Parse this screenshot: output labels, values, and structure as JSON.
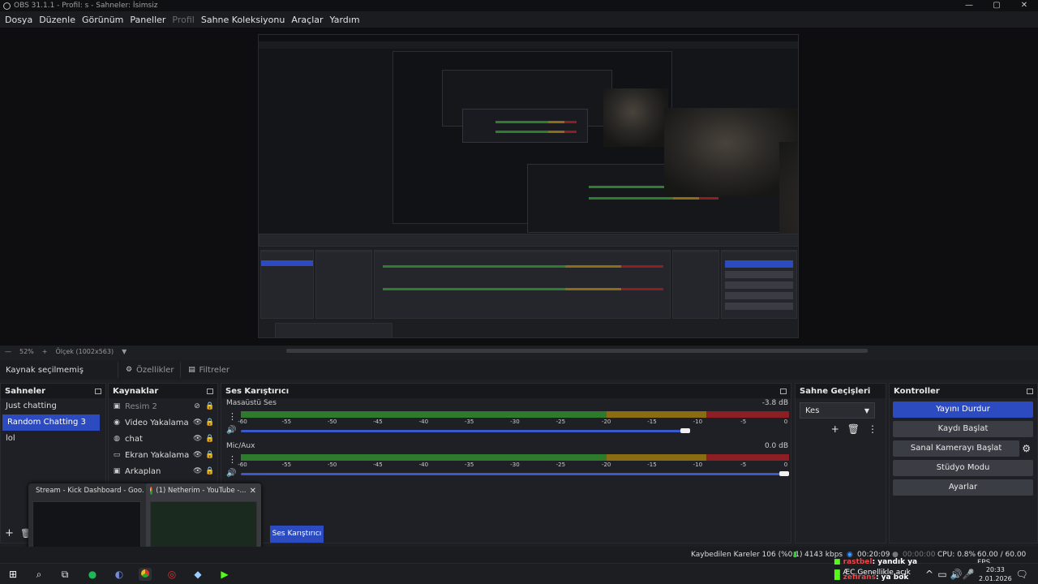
{
  "window": {
    "title": "OBS 31.1.1 - Profil: s - Sahneler: İsimsiz",
    "min": "—",
    "max": "▢",
    "close": "✕"
  },
  "menu": [
    "Dosya",
    "Düzenle",
    "Görünüm",
    "Paneller",
    "Profil",
    "Sahne Koleksiyonu",
    "Araçlar",
    "Yardım"
  ],
  "zoom": {
    "value": "52%",
    "minus": "—",
    "plus": "+",
    "scale_label": "Ölçek (1002x563)"
  },
  "source_bar": {
    "label": "Kaynak seçilmemiş",
    "properties": "Özellikler",
    "filters": "Filtreler"
  },
  "scenes": {
    "title": "Sahneler",
    "items": [
      "Just chatting",
      "Random Chatting 3",
      "lol"
    ],
    "selected": 1
  },
  "sources": {
    "title": "Kaynaklar",
    "items": [
      {
        "name": "Resim 2",
        "icon": "image-icon",
        "hidden": true
      },
      {
        "name": "Video Yakalama Aygıtı",
        "icon": "camera-icon",
        "hidden": false
      },
      {
        "name": "chat",
        "icon": "globe-icon",
        "hidden": false
      },
      {
        "name": "Ekran Yakalama",
        "icon": "monitor-icon",
        "hidden": false
      },
      {
        "name": "Arkaplan",
        "icon": "image-icon",
        "hidden": false
      }
    ]
  },
  "mixer": {
    "title": "Ses Karıştırıcı",
    "tab_label": "Ses Karıştırıcı",
    "channels": [
      {
        "name": "Masaüstü Ses",
        "db": "-3.8 dB",
        "volume": 0.82
      },
      {
        "name": "Mic/Aux",
        "db": "0.0 dB",
        "volume": 1.0
      }
    ],
    "ticks": [
      "-60",
      "-55",
      "-50",
      "-45",
      "-40",
      "-35",
      "-30",
      "-25",
      "-20",
      "-15",
      "-10",
      "-5",
      "0"
    ]
  },
  "transitions": {
    "title": "Sahne Geçişleri",
    "selected": "Kes"
  },
  "controls": {
    "title": "Kontroller",
    "stream": "Yayını Durdur",
    "record": "Kaydı Başlat",
    "vcam": "Sanal Kamerayı Başlat",
    "studio": "Stüdyo Modu",
    "settings": "Ayarlar"
  },
  "taskbar_thumbs": [
    {
      "title": "Stream - Kick Dashboard - Goo..."
    },
    {
      "title": "(1) Netherim - YouTube -..."
    }
  ],
  "status": {
    "dropped": "Kaybedilen Kareler 106 (%0.1)",
    "kbps": "4143 kbps",
    "live_time": "00:20:09",
    "rec_time": "00:00:00",
    "cpu": "CPU: 0.8%",
    "fps": "60.00 / 60.00 FPS"
  },
  "overlay_chat": [
    {
      "user": "rastbel",
      "msg": ": yandık ya"
    },
    {
      "user": "ÆC",
      "msg": "Genellikle açık"
    },
    {
      "user": "zefirans",
      "msg": ": ya bok"
    }
  ],
  "clock": {
    "time": "20:33",
    "date": "2.01.2026"
  },
  "colors": {
    "accent": "#2d4bc0",
    "meter_green": "#2e7b2e",
    "meter_yellow": "#8a6d13",
    "meter_red": "#8b1f24"
  }
}
